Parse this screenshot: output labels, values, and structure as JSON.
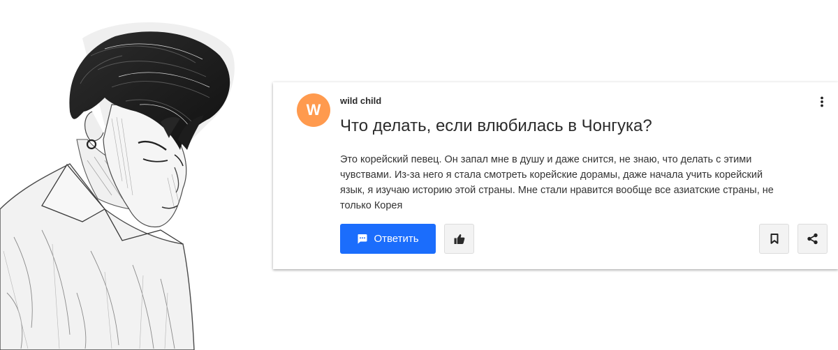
{
  "question": {
    "author": "wild child",
    "avatar_letter": "W",
    "avatar_color": "#ff9a4e",
    "title": "Что делать, если влюбилась в Чонгука?",
    "body_lines": [
      "Это корейский певец. Он запал мне в душу и даже снится, не знаю, что делать с этими",
      "чувствами. Из-за него я стала смотреть корейские дорамы, даже начала учить корейский",
      "язык, я изучаю историю этой страны. Мне стали нравится вообще все азиатские страны, не",
      "только Корея"
    ]
  },
  "actions": {
    "answer_label": "Ответить",
    "answer_icon": "chat-bubble-icon",
    "like_icon": "thumbs-up-icon",
    "bookmark_icon": "bookmark-icon",
    "share_icon": "share-icon",
    "menu_icon": "more-vertical-icon",
    "accent_color": "#1b6dfc"
  },
  "illustration": {
    "subject": "pencil sketch of a young man with tousled hair and an earring, looking down"
  }
}
